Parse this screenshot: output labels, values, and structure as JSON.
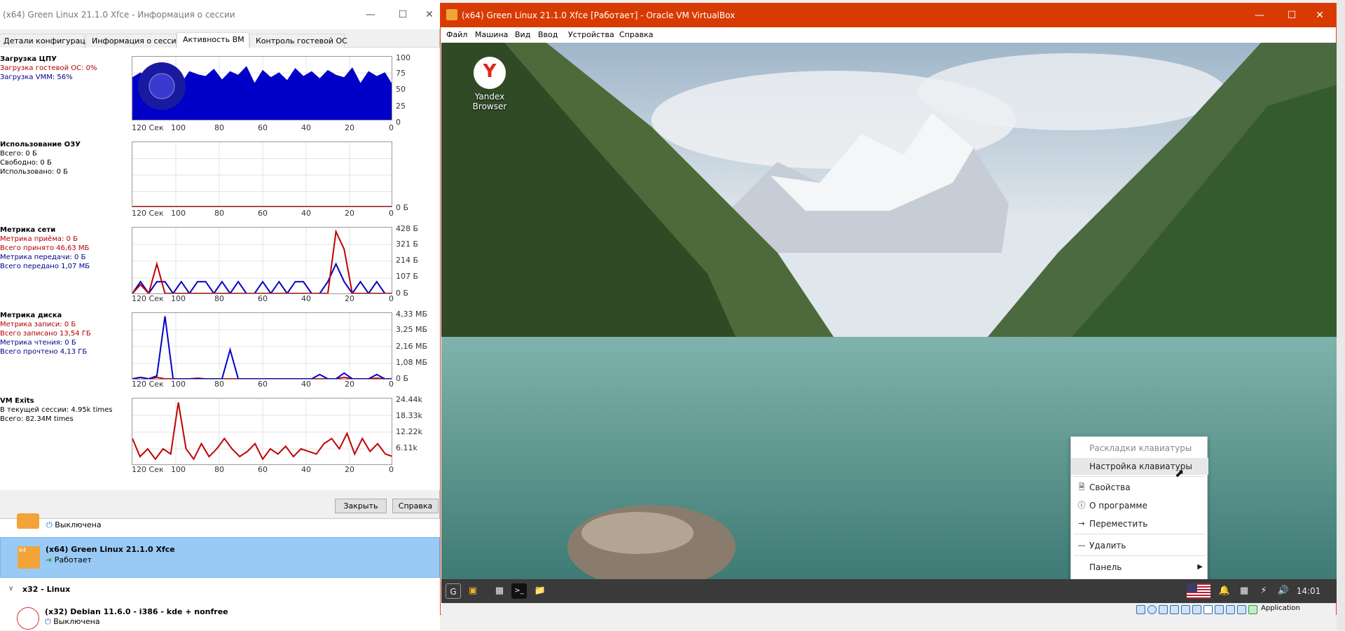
{
  "session_window": {
    "title": "(x64) Green Linux 21.1.0 Xfce - Информация о сессии",
    "tabs": [
      "Детали конфигурации",
      "Информация о сессии",
      "Активность ВМ",
      "Контроль гостевой ОС"
    ],
    "active_tab": "Активность ВМ",
    "cpu": {
      "heading": "Загрузка ЦПУ",
      "guest_load": "Загрузка гостевой ОС: 0%",
      "vmm_load": "Загрузка VMM: 56%",
      "y_ticks": [
        "100",
        "75",
        "50",
        "25",
        "0"
      ]
    },
    "ram": {
      "heading": "Использование ОЗУ",
      "total": "Всего: 0 Б",
      "free": "Свободно: 0 Б",
      "used": "Использовано: 0 Б",
      "y_ticks": [
        "0 Б"
      ]
    },
    "net": {
      "heading": "Метрика сети",
      "rx_rate": "Метрика приёма: 0 Б",
      "rx_total": "Всего принято 46,63 МБ",
      "tx_rate": "Метрика передачи: 0 Б",
      "tx_total": "Всего передано 1,07 МБ",
      "y_ticks": [
        "428 Б",
        "321 Б",
        "214 Б",
        "107 Б",
        "0 Б"
      ]
    },
    "disk": {
      "heading": "Метрика диска",
      "write_rate": "Метрика записи: 0 Б",
      "write_total": "Всего записано 13,54 ГБ",
      "read_rate": "Метрика чтения: 0 Б",
      "read_total": "Всего прочтено 4,13 ГБ",
      "y_ticks": [
        "4,33 МБ",
        "3,25 МБ",
        "2,16 МБ",
        "1,08 МБ",
        "0 Б"
      ]
    },
    "exits": {
      "heading": "VM Exits",
      "session": "В текущей сессии: 4.95k times",
      "total": "Всего: 82.34M times",
      "y_ticks": [
        "24.44k",
        "18.33k",
        "12.22k",
        "6.11k"
      ]
    },
    "x_ticks": [
      "120 Сек",
      "100",
      "80",
      "60",
      "40",
      "20",
      "0"
    ],
    "close_button": "Закрыть",
    "help_button": "Справка"
  },
  "vm_list": {
    "items": [
      {
        "name": "",
        "state": "Выключена"
      },
      {
        "name": "(x64) Green Linux 21.1.0 Xfce",
        "state": "Работает"
      },
      {
        "name": "(x32) Debian 11.6.0 - i386 - kde + nonfree",
        "state": "Выключена"
      }
    ],
    "group": "x32 - Linux"
  },
  "vbox_window": {
    "title": "(x64) Green Linux 21.1.0 Xfce [Работает] - Oracle VM VirtualBox",
    "menu": [
      "Файл",
      "Машина",
      "Вид",
      "Ввод",
      "Устройства",
      "Справка"
    ],
    "desktop_icon_label": "Yandex Browser",
    "context_menu": {
      "header": "Раскладки клавиатуры",
      "items": [
        "Настройка клавиатуры",
        "Свойства",
        "О программе",
        "Переместить",
        "Удалить",
        "Панель"
      ]
    },
    "clock": "14:01",
    "status_app_label": "Application"
  },
  "colors": {
    "vbox_title": "#d83b01",
    "series_blue": "#0000c8",
    "series_red": "#c00000"
  },
  "chart_data": [
    {
      "type": "area",
      "title": "Загрузка ЦПУ",
      "x": [
        120,
        100,
        80,
        60,
        40,
        20,
        0
      ],
      "ylim": [
        0,
        100
      ],
      "series": [
        {
          "name": "Загрузка VMM",
          "values": [
            70,
            78,
            62,
            82,
            70,
            85,
            60,
            80,
            75,
            72,
            84,
            66,
            80,
            74,
            88,
            60,
            82,
            70,
            78,
            65,
            85,
            72,
            80,
            68,
            82,
            74,
            70,
            86,
            60,
            80,
            72,
            78,
            56
          ]
        }
      ]
    },
    {
      "type": "line",
      "title": "Использование ОЗУ",
      "x": [
        120,
        100,
        80,
        60,
        40,
        20,
        0
      ],
      "series": [
        {
          "name": "Использовано",
          "values": [
            0,
            0,
            0,
            0,
            0,
            0,
            0
          ]
        }
      ]
    },
    {
      "type": "line",
      "title": "Метрика сети",
      "x": [
        120,
        100,
        80,
        60,
        40,
        20,
        0
      ],
      "ylim": [
        0,
        428
      ],
      "series": [
        {
          "name": "Метрика приёма",
          "values": [
            0,
            60,
            0,
            200,
            0,
            0,
            0,
            0,
            0,
            0,
            0,
            0,
            0,
            0,
            0,
            0,
            0,
            0,
            0,
            0,
            0,
            0,
            0,
            0,
            0,
            420,
            300,
            0,
            0,
            0,
            0,
            0,
            0
          ]
        },
        {
          "name": "Метрика передачи",
          "values": [
            0,
            80,
            0,
            80,
            80,
            0,
            80,
            0,
            80,
            80,
            0,
            80,
            0,
            80,
            0,
            0,
            80,
            0,
            80,
            0,
            80,
            80,
            0,
            0,
            80,
            200,
            80,
            0,
            80,
            0,
            80,
            0,
            0
          ]
        }
      ]
    },
    {
      "type": "line",
      "title": "Метрика диска",
      "x": [
        120,
        100,
        80,
        60,
        40,
        20,
        0
      ],
      "series": [
        {
          "name": "Метрика записи",
          "values": [
            0,
            0.1,
            0,
            0.1,
            0,
            0,
            0,
            0,
            0.05,
            0,
            0,
            0,
            0,
            0,
            0,
            0,
            0,
            0,
            0,
            0,
            0,
            0,
            0,
            0,
            0,
            0,
            0.1,
            0,
            0,
            0,
            0.05,
            0,
            0
          ]
        },
        {
          "name": "Метрика чтения",
          "values": [
            0,
            0.1,
            0,
            0.2,
            4.3,
            0,
            0,
            0,
            0,
            0,
            0,
            0,
            2.0,
            0,
            0,
            0,
            0,
            0,
            0,
            0,
            0,
            0,
            0,
            0.3,
            0,
            0,
            0.4,
            0,
            0,
            0,
            0.3,
            0,
            0
          ]
        }
      ]
    },
    {
      "type": "line",
      "title": "VM Exits",
      "x": [
        120,
        100,
        80,
        60,
        40,
        20,
        0
      ],
      "series": [
        {
          "name": "VM Exits",
          "values": [
            10,
            3,
            6,
            2,
            6,
            4,
            24,
            6,
            2,
            8,
            3,
            6,
            10,
            6,
            3,
            5,
            8,
            2,
            6,
            4,
            7,
            3,
            6,
            5,
            4,
            8,
            10,
            6,
            12,
            4,
            10,
            5,
            8,
            4,
            3
          ]
        }
      ]
    }
  ]
}
